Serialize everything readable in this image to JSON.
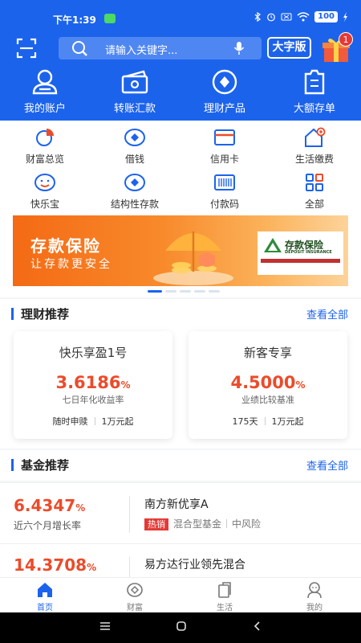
{
  "status_bar": {
    "time": "下午1:39",
    "battery": "100"
  },
  "colors": {
    "brand": "#1c63ec",
    "accent": "#ec4b2a",
    "hot": "#e53935"
  },
  "header": {
    "search_placeholder": "请输入关键字...",
    "large_font_label": "大字版",
    "gift_badge": "1"
  },
  "top_nav": [
    {
      "label": "我的账户",
      "icon": "user-icon"
    },
    {
      "label": "转账汇款",
      "icon": "transfer-icon"
    },
    {
      "label": "理财产品",
      "icon": "wealth-icon"
    },
    {
      "label": "大额存单",
      "icon": "deposit-icon"
    }
  ],
  "grid": [
    {
      "label": "财富总览",
      "icon": "pie-chart-icon"
    },
    {
      "label": "借钱",
      "icon": "loan-icon"
    },
    {
      "label": "信用卡",
      "icon": "credit-card-icon"
    },
    {
      "label": "生活缴费",
      "icon": "home-bill-icon"
    },
    {
      "label": "快乐宝",
      "icon": "smile-icon"
    },
    {
      "label": "结构性存款",
      "icon": "structured-deposit-icon"
    },
    {
      "label": "付款码",
      "icon": "barcode-icon"
    },
    {
      "label": "全部",
      "icon": "all-apps-icon"
    }
  ],
  "banner": {
    "title": "存款保险",
    "subtitle": "让存款更安全",
    "card_title": "存款保险",
    "card_subtitle": "DEPOSIT INSURANCE"
  },
  "wealth_section": {
    "title": "理财推荐",
    "more": "查看全部",
    "cards": [
      {
        "name": "快乐享盈1号",
        "rate": "3.6186",
        "unit": "%",
        "desc": "七日年化收益率",
        "tag1": "随时申赎",
        "tag2": "1万元起"
      },
      {
        "name": "新客专享",
        "rate": "4.5000",
        "unit": "%",
        "desc": "业绩比较基准",
        "tag1": "175天",
        "tag2": "1万元起"
      }
    ]
  },
  "fund_section": {
    "title": "基金推荐",
    "more": "查看全部",
    "funds": [
      {
        "rate": "6.4347",
        "unit": "%",
        "rate_desc": "近六个月增长率",
        "name": "南方新优享A",
        "hot": "热销",
        "type": "混合型基金",
        "risk": "中风险"
      },
      {
        "rate": "14.3708",
        "unit": "%",
        "name": "易方达行业领先混合"
      }
    ]
  },
  "bottom_nav": [
    {
      "label": "首页",
      "icon": "home-icon",
      "active": true
    },
    {
      "label": "财富",
      "icon": "wealth-tab-icon",
      "active": false
    },
    {
      "label": "生活",
      "icon": "life-icon",
      "active": false
    },
    {
      "label": "我的",
      "icon": "profile-icon",
      "active": false
    }
  ]
}
